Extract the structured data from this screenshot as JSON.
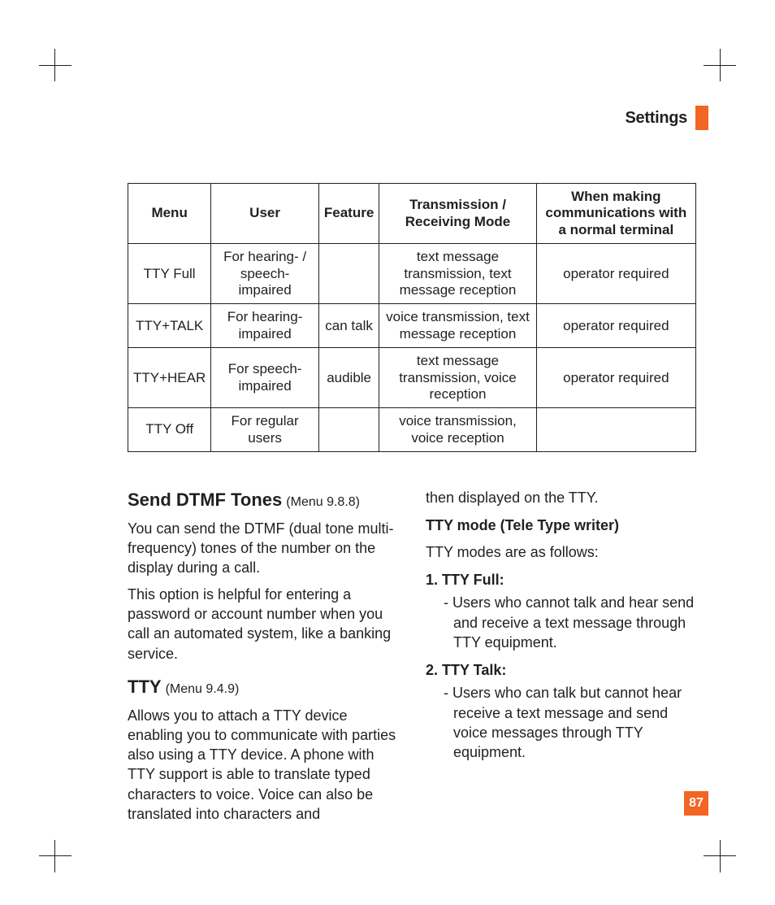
{
  "header": {
    "title": "Settings"
  },
  "page_number": "87",
  "table": {
    "headers": [
      "Menu",
      "User",
      "Feature",
      "Transmission / Receiving Mode",
      "When making communications with a normal terminal"
    ],
    "rows": [
      {
        "menu": "TTY Full",
        "user": "For hearing- / speech- impaired",
        "feature": "",
        "mode": "text message transmission, text message reception",
        "comm": "operator required"
      },
      {
        "menu": "TTY+TALK",
        "user": "For hearing-impaired",
        "feature": "can talk",
        "mode": "voice transmission, text message reception",
        "comm": "operator required"
      },
      {
        "menu": "TTY+HEAR",
        "user": "For speech-impaired",
        "feature": "audible",
        "mode": "text message transmission, voice reception",
        "comm": "operator required"
      },
      {
        "menu": "TTY Off",
        "user": "For regular users",
        "feature": "",
        "mode": "voice transmission, voice reception",
        "comm": ""
      }
    ]
  },
  "left": {
    "dtmf_heading": "Send DTMF Tones",
    "dtmf_menu": "(Menu 9.8.8)",
    "dtmf_p1": "You can send the DTMF (dual tone multi-frequency) tones of the number on the display during a call.",
    "dtmf_p2": "This option is helpful for entering a password or account number when you call an automated system, like a banking service.",
    "tty_heading": "TTY",
    "tty_menu": "(Menu 9.4.9)",
    "tty_p1": "Allows you to attach a TTY device enabling you to communicate with parties also using a TTY device. A phone with TTY support is able to translate typed characters to voice. Voice can also be translated into characters and"
  },
  "right": {
    "cont": "then displayed on the TTY.",
    "mode_heading": "TTY mode (Tele Type writer)",
    "mode_intro": "TTY modes are as follows:",
    "item1_title": "1. TTY Full:",
    "item1_body": "- Users who cannot talk and hear send and receive a text message through TTY equipment.",
    "item2_title": "2. TTY Talk:",
    "item2_body": "- Users who can talk but cannot hear receive a text message and send voice messages through TTY equipment."
  }
}
